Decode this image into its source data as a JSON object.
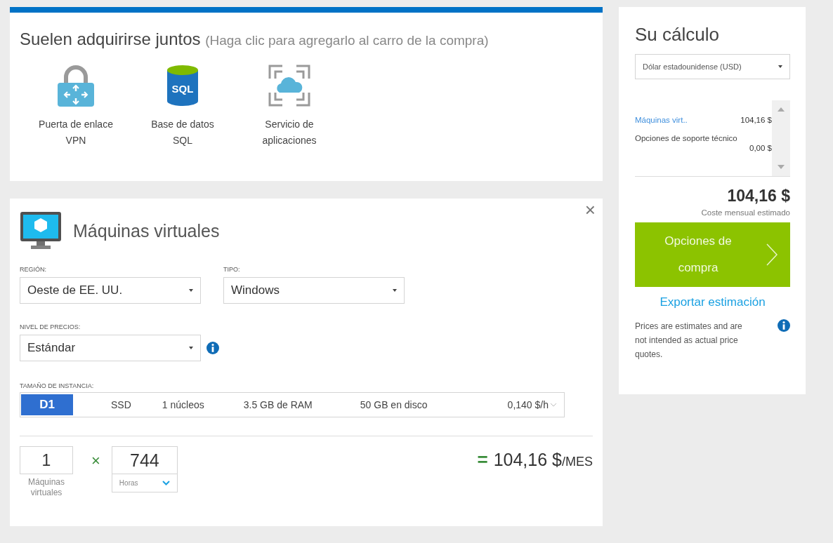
{
  "bundle": {
    "title": "Suelen adquirirse juntos",
    "hint": "(Haga clic para agregarlo al carro de la compra)",
    "products": [
      {
        "kind": "vpn",
        "label": "Puerta de enlace VPN"
      },
      {
        "kind": "sql",
        "label": "Base de datos SQL",
        "icon_text": "SQL"
      },
      {
        "kind": "app",
        "label": "Servicio de aplicaciones"
      }
    ]
  },
  "service": {
    "title": "Máquinas virtuales",
    "close": "×",
    "region": {
      "label": "REGIÓN:",
      "value": "Oeste de EE. UU."
    },
    "type": {
      "label": "TIPO:",
      "value": "Windows"
    },
    "tier": {
      "label": "NIVEL DE PRECIOS:",
      "value": "Estándar"
    },
    "instance": {
      "label": "TAMAÑO DE INSTANCIA:",
      "size": "D1",
      "disk": "SSD",
      "cores": "1 núcleos",
      "ram": "3.5 GB de RAM",
      "storage": "50 GB en disco",
      "price": "0,140 $/h"
    },
    "quantity": {
      "value": "1",
      "label": "Máquinas virtuales"
    },
    "times": "×",
    "hours": {
      "value": "744",
      "unit": "Horas"
    },
    "total": {
      "equals": "=",
      "amount": "104,16 $",
      "per": "/MES"
    }
  },
  "estimate": {
    "title": "Su cálculo",
    "currency": "Dólar estadounidense (USD)",
    "lines": [
      {
        "kind": "link",
        "name": "Máquinas virt..",
        "amount": "104,16 $"
      },
      {
        "kind": "text",
        "name": "Opciones de soporte técnico",
        "amount": "0,00 $"
      }
    ],
    "total": "104,16 $",
    "total_label": "Coste mensual estimado",
    "buy": "Opciones de compra",
    "export": "Exportar estimación",
    "note": "Prices are estimates and are not intended as actual price quotes."
  }
}
